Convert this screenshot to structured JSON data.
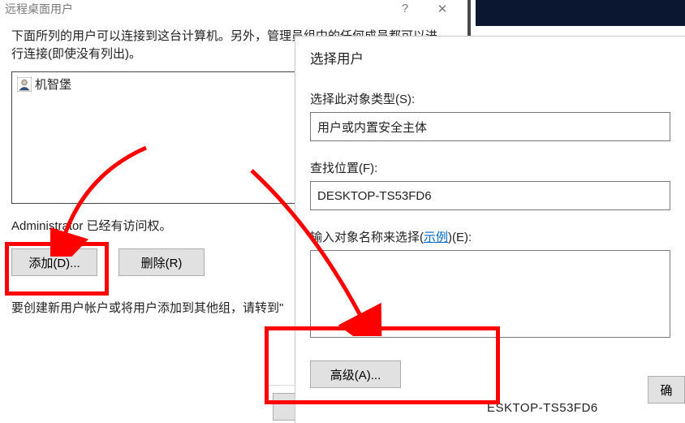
{
  "rdu": {
    "title": "远程桌面用户",
    "desc": "下面所列的用户可以连接到这台计算机。另外，管理员组中的任何成员都可以进行连接(即使没有列出)。",
    "user": "机智堡",
    "access_note": "Administrator 已经有访问权。",
    "add_btn": "添加(D)...",
    "remove_btn": "删除(R)",
    "create_note": "要创建新用户帐户或将用户添加到其他组，请转到\"",
    "ok_btn": "确"
  },
  "su": {
    "title": "选择用户",
    "obj_type_label": "选择此对象类型(S):",
    "obj_type_value": "用户或内置安全主体",
    "loc_label": "查找位置(F):",
    "loc_value": "DESKTOP-TS53FD6",
    "names_label_pre": "输入对象名称来选择(",
    "names_label_link": "示例",
    "names_label_post": ")(E):",
    "adv_btn": "高级(A)...",
    "confirm_btn": "确"
  },
  "footer_desktop": "ESKTOP-TS53FD6"
}
